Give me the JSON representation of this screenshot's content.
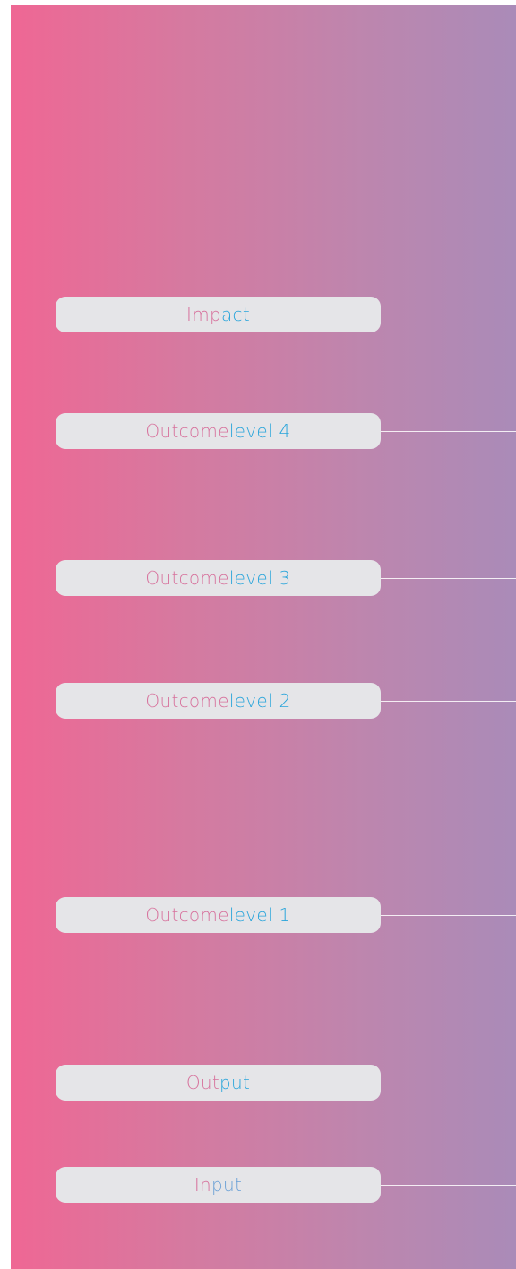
{
  "levels": [
    {
      "parts": [
        "Imp",
        "act"
      ],
      "colors": [
        "#d7719c",
        "#2aa5db"
      ]
    },
    {
      "parts": [
        "Outcome ",
        "level 4"
      ],
      "colors": [
        "#d7719c",
        "#2aa5db"
      ]
    },
    {
      "parts": [
        "Outcome ",
        "level 3"
      ],
      "colors": [
        "#d7719c",
        "#2aa5db"
      ]
    },
    {
      "parts": [
        "Outcome ",
        "level 2"
      ],
      "colors": [
        "#d7719c",
        "#2aa5db"
      ]
    },
    {
      "parts": [
        "Outcome ",
        "level 1"
      ],
      "colors": [
        "#d7719c",
        "#2aa5db"
      ]
    },
    {
      "parts": [
        "Out",
        "put"
      ],
      "colors": [
        "#d7719c",
        "#2aa5db"
      ]
    },
    {
      "parts": [
        "In",
        "put"
      ],
      "colors": [
        "#d7719c",
        "#6aa0d6"
      ]
    }
  ],
  "colors": {
    "gradient_left": "#ef6794",
    "gradient_right": "#aa8bb8",
    "box_fill": "#e5e5e8",
    "connector": "#ffffff"
  }
}
